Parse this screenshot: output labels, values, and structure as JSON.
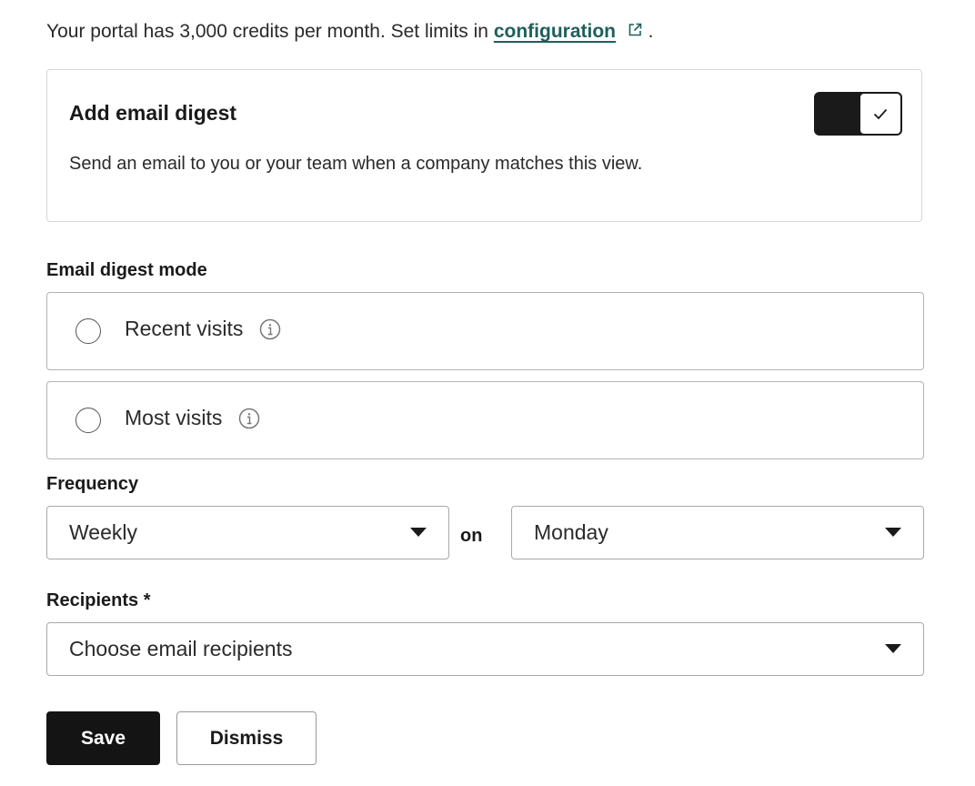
{
  "credits": {
    "prefix": "Your portal has 3,000 credits per month. Set limits in",
    "link_label": "configuration",
    "link_icon": "external-link-icon",
    "suffix": "."
  },
  "digest_card": {
    "title": "Add email digest",
    "description": "Send an email to you or your team when a company matches this view.",
    "toggle_on": true,
    "toggle_icon": "checkmark-icon"
  },
  "mode": {
    "label": "Email digest mode",
    "options": [
      {
        "label": "Recent visits",
        "selected": false,
        "icon": "info-icon"
      },
      {
        "label": "Most visits",
        "selected": false,
        "icon": "info-icon"
      }
    ]
  },
  "frequency": {
    "label": "Frequency",
    "period_value": "Weekly",
    "connector": "on",
    "day_value": "Monday"
  },
  "recipients": {
    "label": "Recipients *",
    "placeholder": "Choose email recipients"
  },
  "actions": {
    "save_label": "Save",
    "dismiss_label": "Dismiss"
  },
  "colors": {
    "link": "#1f5f5b",
    "primary_button": "#141414",
    "toggle_track": "#1a1a1a",
    "border": "#b3b3b3"
  }
}
